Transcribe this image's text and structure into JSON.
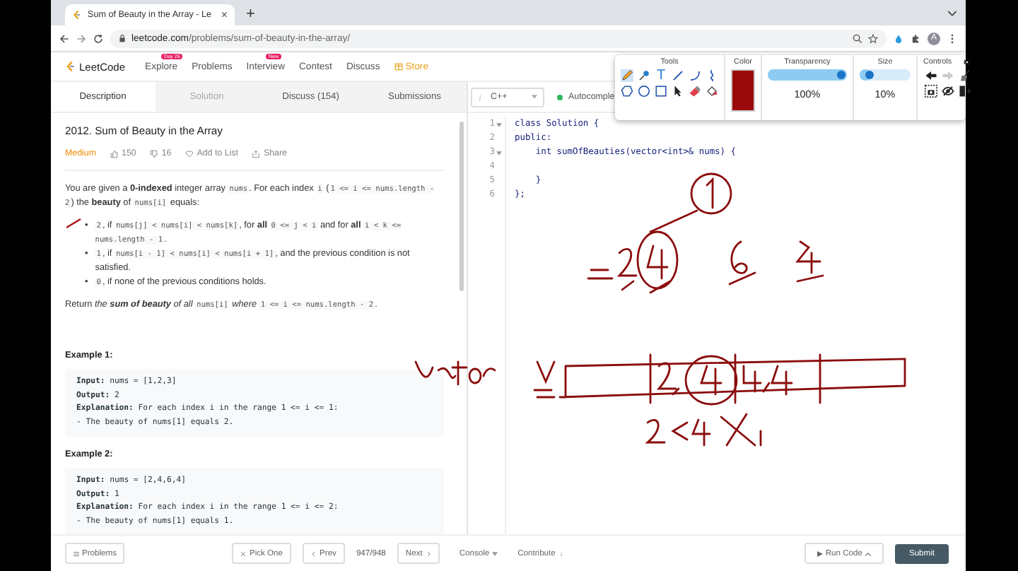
{
  "browser": {
    "tab_title": "Sum of Beauty in the Array - Le",
    "tab_close": "×",
    "new_tab": "+",
    "url_host": "leetcode.com",
    "url_path": "/problems/sum-of-beauty-in-the-array/",
    "avatar": "A"
  },
  "nav": {
    "logo": "LeetCode",
    "items": [
      {
        "label": "Explore",
        "badge": "Day 26",
        "kind": "link"
      },
      {
        "label": "Problems",
        "kind": "link"
      },
      {
        "label": "Interview",
        "badge": "New",
        "kind": "link"
      },
      {
        "label": "Contest",
        "kind": "link"
      },
      {
        "label": "Discuss",
        "kind": "link"
      },
      {
        "label": "Store",
        "kind": "store"
      }
    ]
  },
  "panel_tabs": [
    {
      "label": "Description",
      "selected": true,
      "disabled": false
    },
    {
      "label": "Solution",
      "selected": false,
      "disabled": true
    },
    {
      "label": "Discuss (154)",
      "selected": false,
      "disabled": false
    },
    {
      "label": "Submissions",
      "selected": false,
      "disabled": false
    }
  ],
  "editor_header": {
    "language": "C++",
    "autocomplete": "Autocomple",
    "autocomplete_on": true
  },
  "problem": {
    "title": "2012. Sum of Beauty in the Array",
    "difficulty": "Medium",
    "likes": "150",
    "dislikes": "16",
    "add_to_list": "Add to List",
    "share": "Share",
    "intro": [
      {
        "kind": "text",
        "text": "You are given a **0-indexed** integer array "
      },
      {
        "kind": "code",
        "text": "nums"
      },
      {
        "kind": "text",
        "text": ". For each index "
      },
      {
        "kind": "code",
        "text": "i"
      },
      {
        "kind": "text",
        "text": " ("
      },
      {
        "kind": "code",
        "text": "1 <= i <= nums.length - 2"
      },
      {
        "kind": "text",
        "text": ") the **beauty** of "
      },
      {
        "kind": "code",
        "text": "nums[i]"
      },
      {
        "kind": "text",
        "text": " equals:"
      }
    ],
    "bullets": [
      {
        "marker": "•",
        "parts": [
          {
            "kind": "code",
            "text": "2"
          },
          {
            "kind": "text",
            "text": ", if "
          },
          {
            "kind": "code",
            "text": "nums[j] < nums[i] < nums[k]"
          },
          {
            "kind": "text",
            "text": ", for **all** "
          },
          {
            "kind": "code",
            "text": "0 <= j < i"
          },
          {
            "kind": "text",
            "text": " and for **all** "
          },
          {
            "kind": "code",
            "text": "i < k <= nums.length - 1"
          },
          {
            "kind": "text",
            "text": "."
          }
        ]
      },
      {
        "marker": "•",
        "parts": [
          {
            "kind": "code",
            "text": "1"
          },
          {
            "kind": "text",
            "text": ", if "
          },
          {
            "kind": "code",
            "text": "nums[i - 1] < nums[i] < nums[i + 1]"
          },
          {
            "kind": "text",
            "text": ", and the previous condition is not satisfied."
          }
        ]
      },
      {
        "marker": "•",
        "parts": [
          {
            "kind": "code",
            "text": "0"
          },
          {
            "kind": "text",
            "text": ", if none of the previous conditions holds."
          }
        ]
      }
    ],
    "returns": [
      {
        "kind": "text",
        "text": "Return *the* **sum of beauty** *of all* "
      },
      {
        "kind": "code",
        "text": "nums[i]"
      },
      {
        "kind": "text",
        "text": " *where* "
      },
      {
        "kind": "code",
        "text": "1 <= i <= nums.length - 2"
      },
      {
        "kind": "text",
        "text": "."
      }
    ],
    "examples": [
      {
        "title": "Example 1:",
        "lines": [
          {
            "label": "Input:",
            "text": " nums = [1,2,3]"
          },
          {
            "label": "Output:",
            "text": " 2"
          },
          {
            "label": "Explanation:",
            "text": " For each index i in the range 1 <= i <= 1:"
          },
          {
            "text": "- The beauty of nums[1] equals 2."
          }
        ]
      },
      {
        "title": "Example 2:",
        "lines": [
          {
            "label": "Input:",
            "text": " nums = [2,4,6,4]"
          },
          {
            "label": "Output:",
            "text": " 1"
          },
          {
            "label": "Explanation:",
            "text": " For each index i in the range 1 <= i <= 2:"
          },
          {
            "text": "- The beauty of nums[1] equals 1."
          }
        ]
      }
    ]
  },
  "editor": {
    "lines": [
      {
        "number": "1",
        "foldable": true,
        "code": "class Solution {"
      },
      {
        "number": "2",
        "foldable": false,
        "code": "public:"
      },
      {
        "number": "3",
        "foldable": true,
        "code": "    int sumOfBeauties(vector<int>& nums) {"
      },
      {
        "number": "4",
        "foldable": false
      },
      {
        "number": "5",
        "foldable": false,
        "code": "    }"
      },
      {
        "number": "6",
        "foldable": false,
        "code": "};"
      }
    ]
  },
  "annotation_toolbar": {
    "tools_label": "Tools",
    "text_tool": "T",
    "color_label": "Color",
    "color": "#9b0a0a",
    "transparency_label": "Transparency",
    "transparency": {
      "level": 1,
      "reading": "100%"
    },
    "size_label": "Size",
    "size": {
      "level": 0.1,
      "reading": "10%"
    },
    "controls_label": "Controls"
  },
  "bottom_bar": {
    "problems": "Problems",
    "pick_one": "Pick One",
    "prev": "Prev",
    "counter": "947/948",
    "next": "Next",
    "console": "Console",
    "contribute": "Contribute",
    "run_code": "Run Code",
    "submit": "Submit"
  }
}
